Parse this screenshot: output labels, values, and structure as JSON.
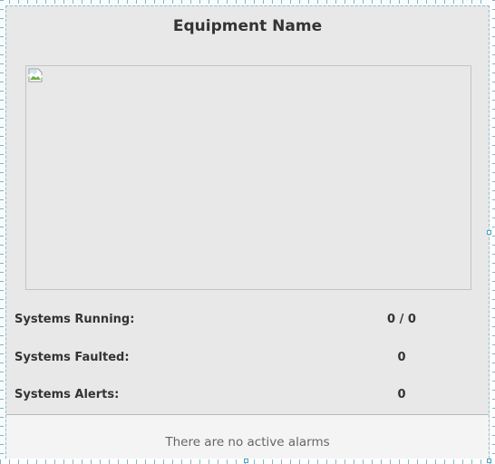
{
  "card": {
    "title": "Equipment Name",
    "image": {
      "icon": "broken-image-icon"
    },
    "stats": [
      {
        "label": "Systems Running:",
        "value": "0 / 0"
      },
      {
        "label": "Systems Faulted:",
        "value": "0"
      },
      {
        "label": "Systems Alerts:",
        "value": "0"
      }
    ],
    "alarms": {
      "message": "There are no active alarms"
    }
  },
  "colors": {
    "panel_background": "#e8e8e8",
    "alarm_background": "#f4f4f4",
    "text": "#333333",
    "muted_text": "#666666",
    "designer_guides": "#7fb6c7"
  }
}
